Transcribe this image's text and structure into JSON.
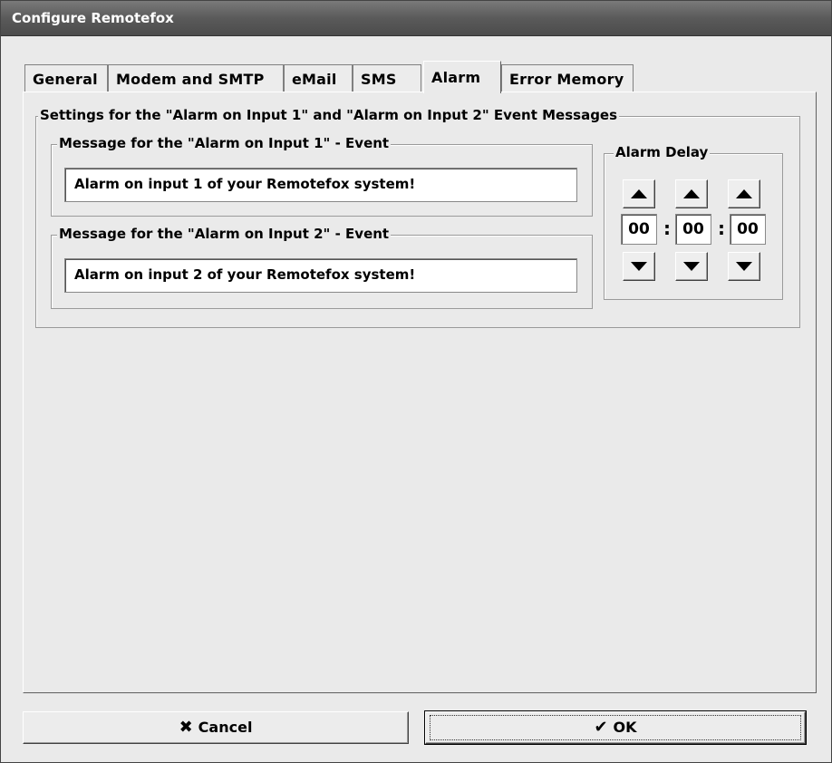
{
  "window": {
    "title": "Configure Remotefox"
  },
  "tabs": [
    {
      "label": "General"
    },
    {
      "label": "Modem and SMTP"
    },
    {
      "label": "eMail"
    },
    {
      "label": "SMS"
    },
    {
      "label": "Alarm"
    },
    {
      "label": "Error Memory"
    }
  ],
  "active_tab": "Alarm",
  "settings_group": {
    "label": "Settings for the \"Alarm on Input 1\" and \"Alarm on Input 2\" Event Messages"
  },
  "input1": {
    "label": "Message for the \"Alarm on Input 1\" - Event",
    "value": "Alarm on input 1 of your Remotefox system!"
  },
  "input2": {
    "label": "Message for the \"Alarm on Input 2\" - Event",
    "value": "Alarm on input 2 of your Remotefox system!"
  },
  "alarm_delay": {
    "label": "Alarm Delay",
    "hours": "00",
    "minutes": "00",
    "seconds": "00",
    "separator": ":"
  },
  "buttons": {
    "cancel_label": "Cancel",
    "cancel_icon": "x-icon",
    "ok_label": "OK",
    "ok_icon": "checkmark-icon"
  }
}
